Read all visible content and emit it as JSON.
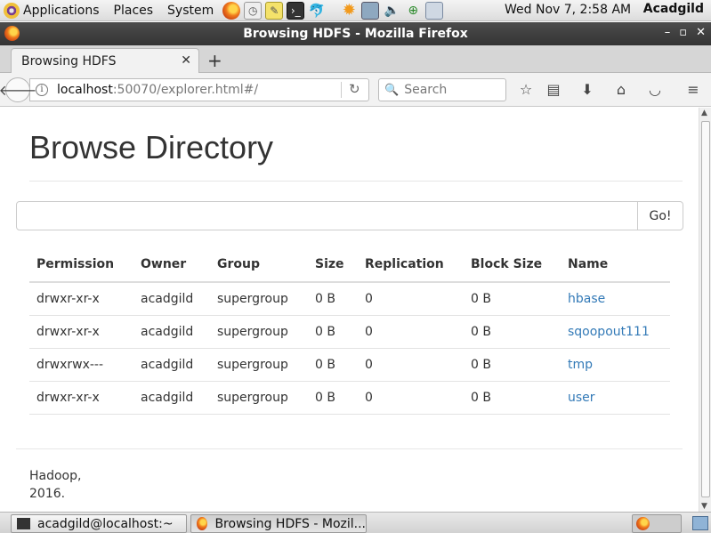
{
  "panel": {
    "applications_label": "Applications",
    "places_label": "Places",
    "system_label": "System",
    "clock": "Wed Nov  7,  2:58 AM",
    "user": "Acadgild"
  },
  "window": {
    "title": "Browsing HDFS - Mozilla Firefox"
  },
  "tabs": [
    {
      "label": "Browsing HDFS"
    }
  ],
  "navbar": {
    "url_host": "localhost",
    "url_rest": ":50070/explorer.html#/",
    "search_placeholder": "Search"
  },
  "page": {
    "title": "Browse Directory",
    "go_label": "Go!",
    "columns": [
      "Permission",
      "Owner",
      "Group",
      "Size",
      "Replication",
      "Block Size",
      "Name"
    ],
    "rows": [
      {
        "permission": "drwxr-xr-x",
        "owner": "acadgild",
        "group": "supergroup",
        "size": "0 B",
        "replication": "0",
        "block_size": "0 B",
        "name": "hbase"
      },
      {
        "permission": "drwxr-xr-x",
        "owner": "acadgild",
        "group": "supergroup",
        "size": "0 B",
        "replication": "0",
        "block_size": "0 B",
        "name": "sqoopout111"
      },
      {
        "permission": "drwxrwx---",
        "owner": "acadgild",
        "group": "supergroup",
        "size": "0 B",
        "replication": "0",
        "block_size": "0 B",
        "name": "tmp"
      },
      {
        "permission": "drwxr-xr-x",
        "owner": "acadgild",
        "group": "supergroup",
        "size": "0 B",
        "replication": "0",
        "block_size": "0 B",
        "name": "user"
      }
    ],
    "footer_line1": "Hadoop,",
    "footer_line2": "2016."
  },
  "taskbar": {
    "terminal_label": "acadgild@localhost:~",
    "firefox_label": "Browsing HDFS - Mozil..."
  },
  "colors": {
    "link": "#337ab7",
    "titlebar": "#3d3d3d"
  }
}
